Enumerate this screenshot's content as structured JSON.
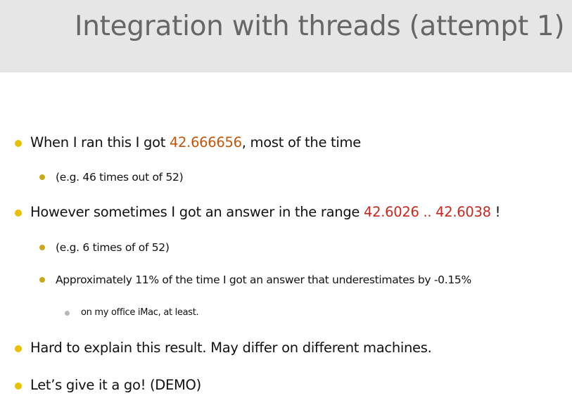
{
  "slide": {
    "title": "Integration with threads (attempt 1)"
  },
  "bullets": {
    "b1": {
      "pre": "When I ran this I got ",
      "value": "42.666656",
      "post": ", most of the time"
    },
    "b1a": {
      "text": "(e.g. 46 times out of 52)"
    },
    "b2": {
      "pre": "However sometimes I got an answer in the range  ",
      "value": "42.6026 .. 42.6038",
      "post": " !"
    },
    "b2a": {
      "text": "(e.g. 6 times of of 52)"
    },
    "b2b": {
      "text": "Approximately 11% of the time I got an answer that underestimates by -0.15%"
    },
    "b2b1": {
      "text": "on my office iMac, at least."
    },
    "b3": {
      "text": "Hard to explain this result. May differ on different machines."
    },
    "b4": {
      "text": "Let’s give it a go!  (DEMO)"
    }
  },
  "colors": {
    "bullet_level1": "#e8c200",
    "bullet_level2": "#c9ab1a",
    "bullet_level3": "#b8b8b8",
    "highlight_orange": "#c0560a",
    "highlight_red": "#c8281e",
    "title_text": "#666666",
    "title_band": "#e6e6e6"
  }
}
